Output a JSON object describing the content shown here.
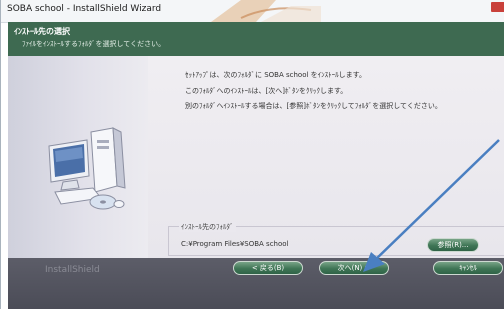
{
  "window": {
    "title": "SOBA school - InstallShield Wizard"
  },
  "header": {
    "title": "ｲﾝｽﾄｰﾙ先の選択",
    "subtitle": "ﾌｧｲﾙをｲﾝｽﾄｰﾙするﾌｫﾙﾀﾞを選択してください。"
  },
  "body": {
    "messages": [
      "ｾｯﾄｱｯﾌﾟは、次のﾌｫﾙﾀﾞに SOBA school をｲﾝｽﾄｰﾙします。",
      "このﾌｫﾙﾀﾞへのｲﾝｽﾄｰﾙは、[次へ]ﾎﾞﾀﾝをｸﾘｯｸします。",
      "別のﾌｫﾙﾀﾞへｲﾝｽﾄｰﾙする場合は、[参照]ﾎﾞﾀﾝをｸﾘｯｸしてﾌｫﾙﾀﾞを選択してください。"
    ],
    "folder_group_label": "ｲﾝｽﾄｰﾙ先のﾌｫﾙﾀﾞ",
    "folder_path": "C:¥Program Files¥SOBA school",
    "browse_label": "参照(R)..."
  },
  "footer": {
    "brand": "InstallShield",
    "back_label": "< 戻る(B)",
    "next_label": "次へ(N) >",
    "cancel_label": "ｷｬﾝｾﾙ"
  },
  "colors": {
    "header_green": "#3e6a51",
    "button_green": "#3f7555",
    "arrow_blue": "#4a7fc1",
    "footer_gray": "#55565f"
  }
}
